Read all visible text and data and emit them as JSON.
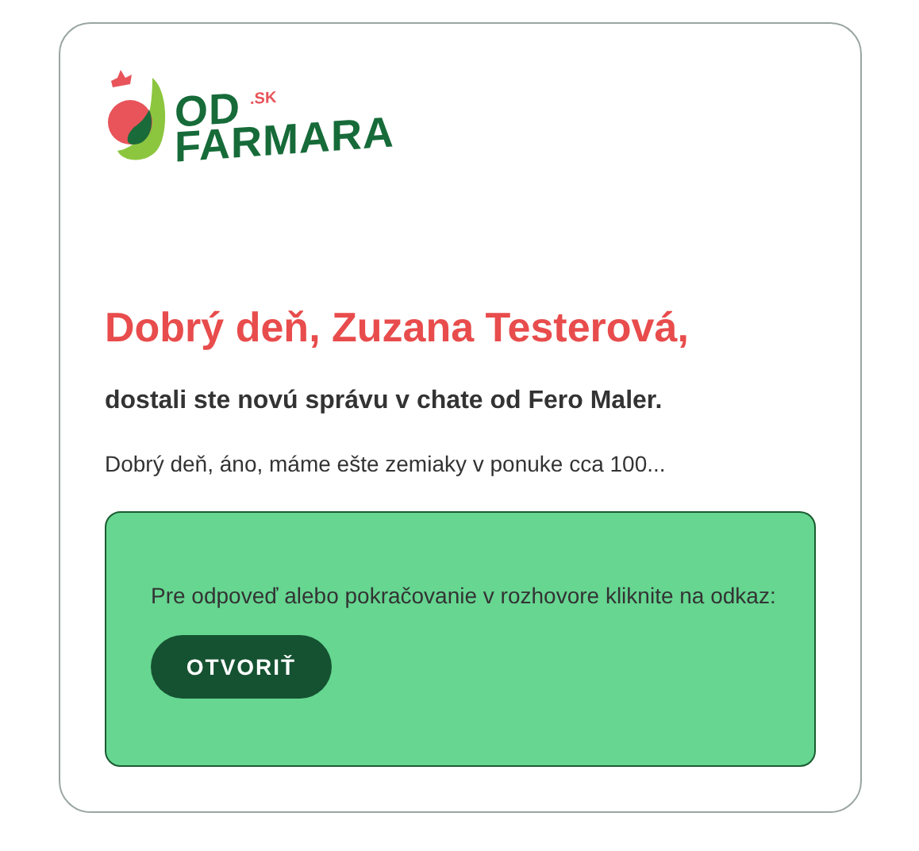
{
  "logo": {
    "line_1": "OD",
    "suffix": ".SK",
    "line_2": "FARMARA"
  },
  "greeting": "Dobrý deň, Zuzana Testerová,",
  "subtitle": "dostali ste novú správu v chate od Fero Maler.",
  "preview": "Dobrý deň, áno, máme ešte zemiaky v ponuke cca 100...",
  "callout": {
    "text": "Pre odpoveď alebo pokračovanie v rozhovore kliknite na odkaz:",
    "button": "OTVORIŤ"
  }
}
